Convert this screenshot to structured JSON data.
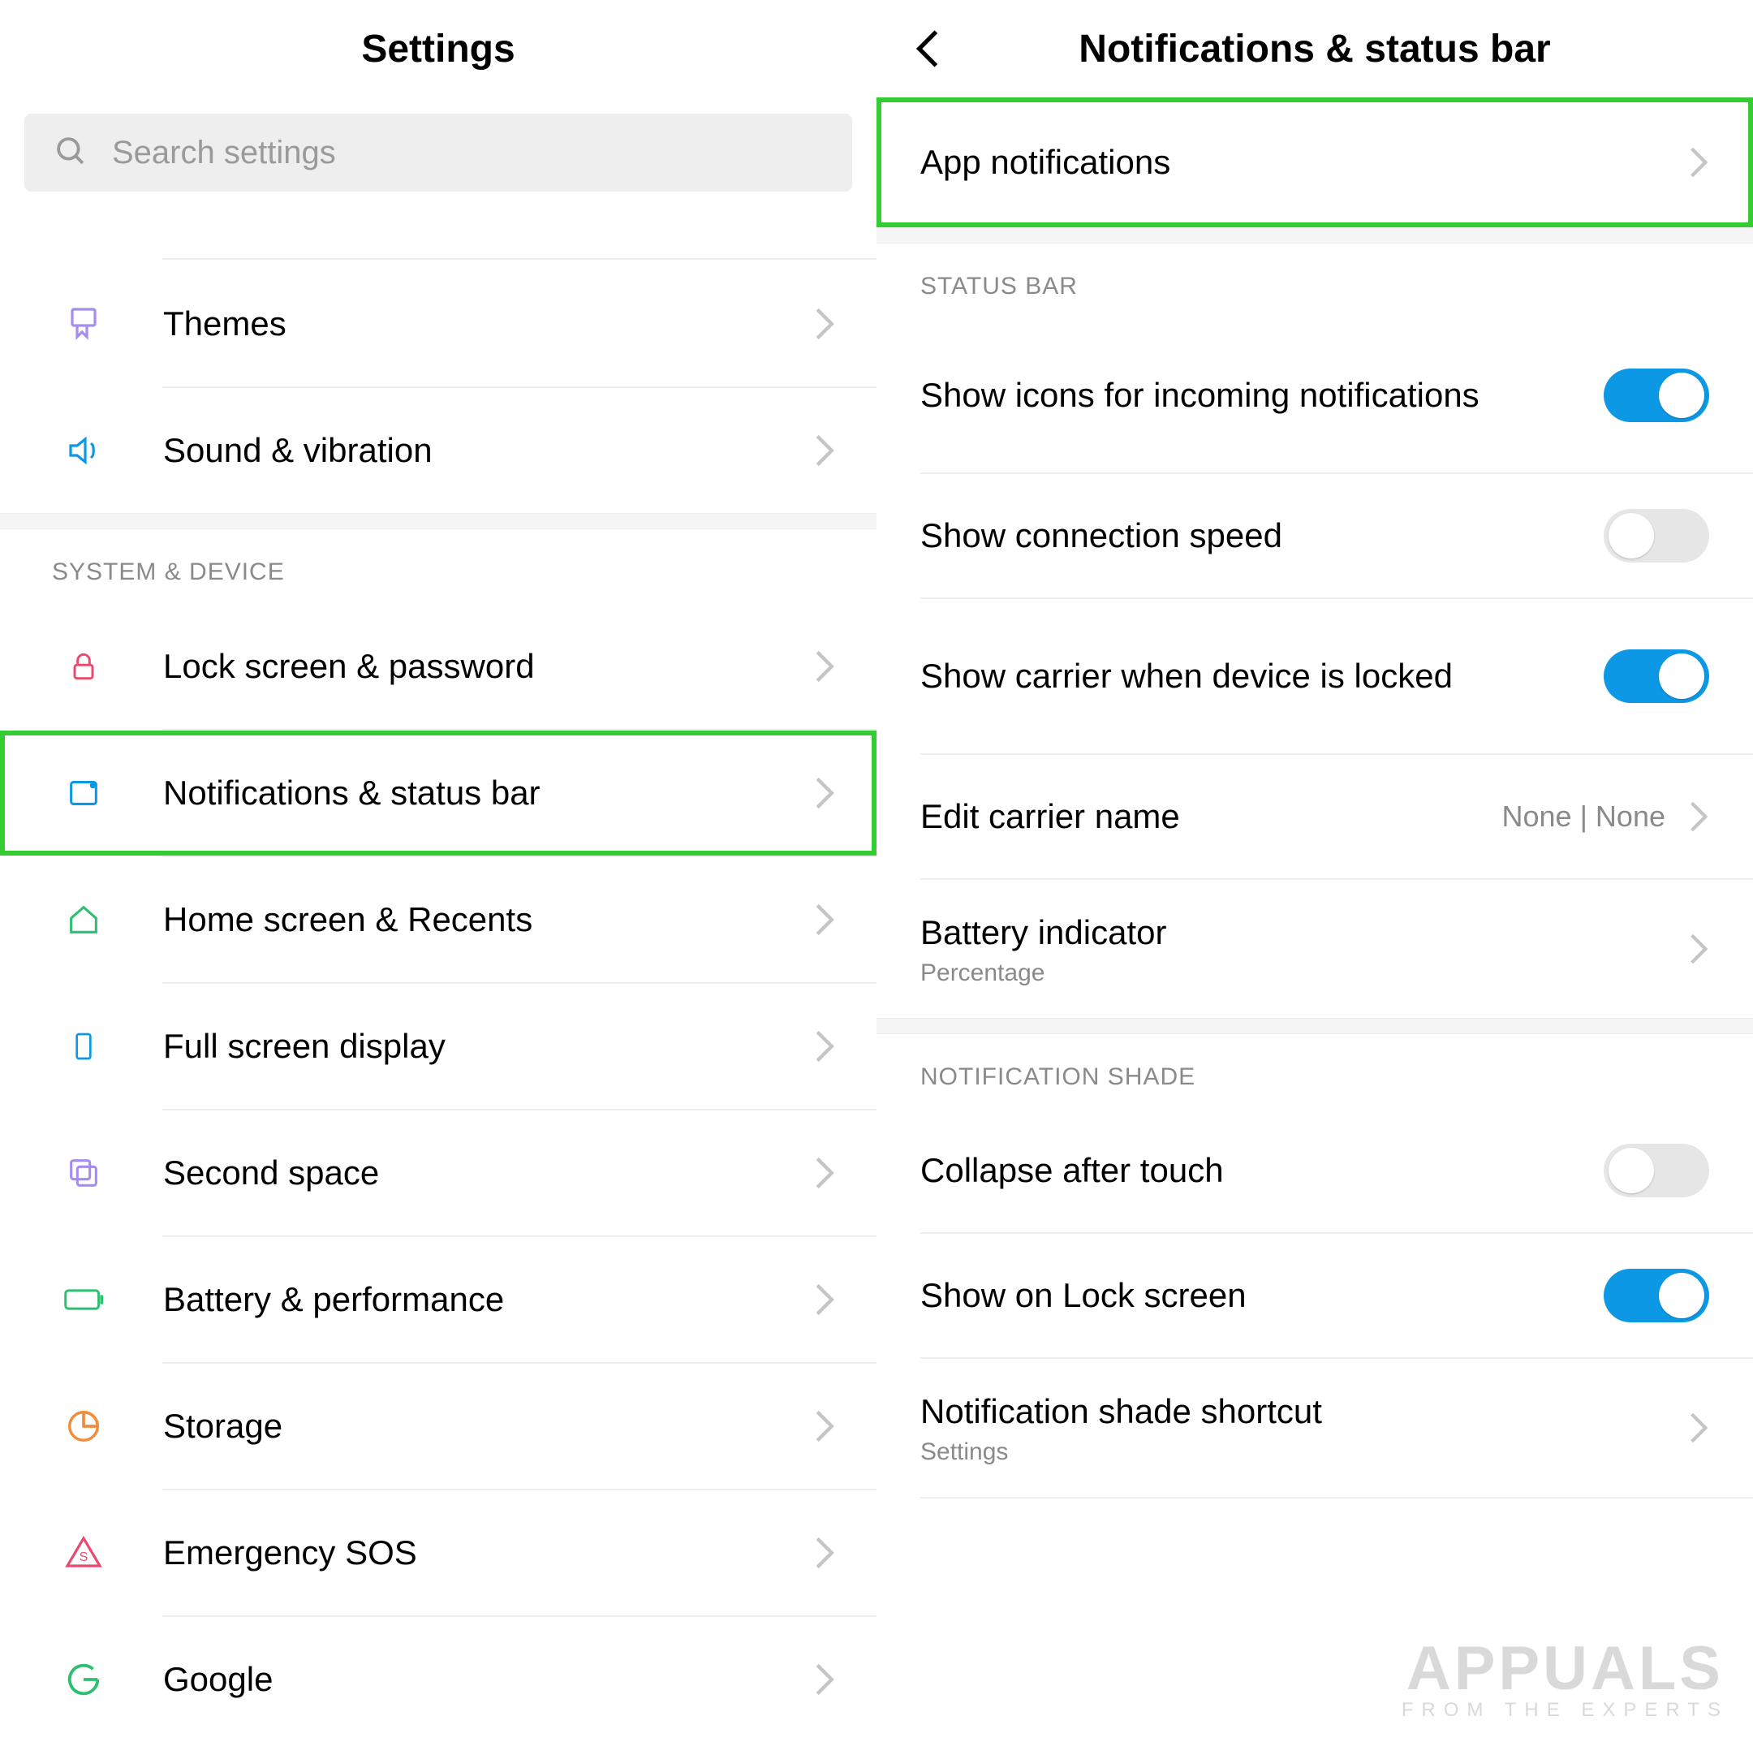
{
  "left": {
    "title": "Settings",
    "search_placeholder": "Search settings",
    "items_top": [
      {
        "label": "Themes"
      },
      {
        "label": "Sound & vibration"
      }
    ],
    "section_system_label": "SYSTEM & DEVICE",
    "items_system": [
      {
        "label": "Lock screen & password"
      },
      {
        "label": "Notifications & status bar",
        "highlighted": true
      },
      {
        "label": "Home screen & Recents"
      },
      {
        "label": "Full screen display"
      },
      {
        "label": "Second space"
      },
      {
        "label": "Battery & performance"
      },
      {
        "label": "Storage"
      },
      {
        "label": "Emergency SOS"
      },
      {
        "label": "Google"
      }
    ]
  },
  "right": {
    "title": "Notifications & status bar",
    "app_notifications_label": "App notifications",
    "section_status_bar_label": "STATUS BAR",
    "status_bar_items": [
      {
        "label": "Show icons for incoming notifications",
        "toggle": true
      },
      {
        "label": "Show connection speed",
        "toggle": false
      },
      {
        "label": "Show carrier when device is locked",
        "toggle": true
      },
      {
        "label": "Edit carrier name",
        "value": "None | None"
      },
      {
        "label": "Battery indicator",
        "sub": "Percentage"
      }
    ],
    "section_shade_label": "NOTIFICATION SHADE",
    "shade_items": [
      {
        "label": "Collapse after touch",
        "toggle": false
      },
      {
        "label": "Show on Lock screen",
        "toggle": true
      },
      {
        "label": "Notification shade shortcut",
        "sub": "Settings"
      }
    ]
  },
  "watermark": {
    "main": "APPUALS",
    "sub": "FROM THE EXPERTS"
  }
}
